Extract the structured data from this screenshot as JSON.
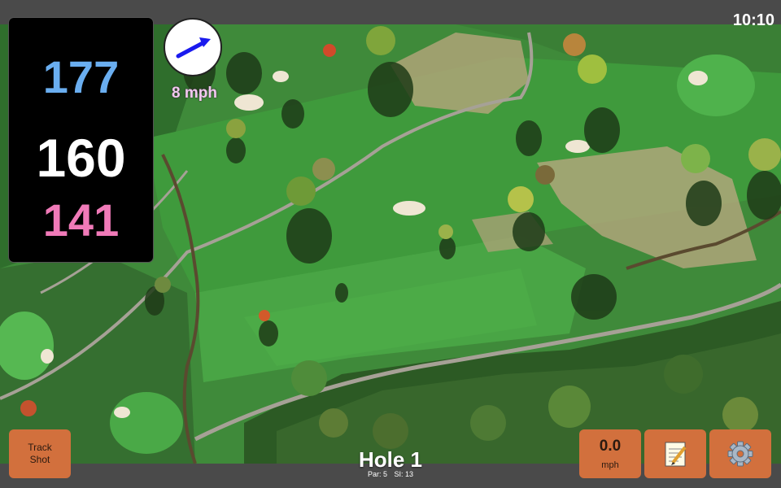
{
  "status_bar": {
    "time": "10:10"
  },
  "yardage": {
    "back": "177",
    "middle": "160",
    "front": "141"
  },
  "wind": {
    "speed": "8 mph",
    "icon": "wind-arrow-icon"
  },
  "buttons": {
    "track_shot_line1": "Track",
    "track_shot_line2": "Shot",
    "speed_value": "0.0",
    "speed_unit": "mph",
    "notes_icon": "notepad-icon",
    "settings_icon": "gear-icon"
  },
  "hole": {
    "title": "Hole 1",
    "par": "Par: 5",
    "si": "SI: 13"
  },
  "colors": {
    "back_yardage": "#6aaef0",
    "middle_yardage": "#ffffff",
    "front_yardage": "#f07ab8",
    "button": "#d2703d",
    "wind_arrow": "#1a1aee"
  }
}
